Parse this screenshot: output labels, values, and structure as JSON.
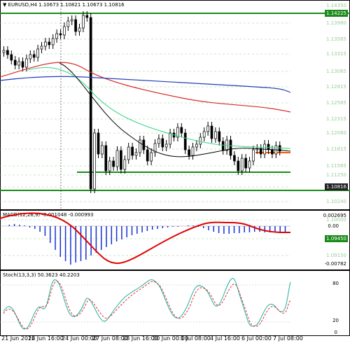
{
  "main_panel": {
    "header": "EURUSD,H4  1.10673 1.10821 1.10673 1.10816",
    "price_labels": [
      "1.14350",
      "1.14225",
      "1.13980",
      "1.13565",
      "1.13315",
      "1.13065",
      "1.12815",
      "1.12565",
      "1.12315",
      "1.12060",
      "1.11815",
      "1.11565",
      "1.11250",
      "1.10816",
      "1.10240",
      "1.10000",
      "1.09450",
      "1.09150"
    ],
    "current_price": "1.10816",
    "highlight_level": "1.14225",
    "support_level": "1.09450"
  },
  "macd_panel": {
    "header": "MACD(12,26,9) -0.001048 -0.000993",
    "scale_top": "0.002695",
    "scale_zero": "0.00",
    "scale_bottom": "-0.00782"
  },
  "stoch_panel": {
    "header": "Stoch(13,3,3) 50.3623 40.2203",
    "scale_top": "80",
    "scale_mid": "20",
    "scale_bottom": "0"
  },
  "x_axis_labels": [
    "21 Jun 2016",
    "22 Jun 16:00",
    "24 Jun 00:00",
    "27 Jun 08:00",
    "28 Jun 16:00",
    "30 Jun 00:00",
    "1 Jul 08:00",
    "4 Jul 16:00",
    "6 Jul 00:00",
    "7 Jul 08:00"
  ],
  "colors": {
    "ma_red": "#d92b2b",
    "ma_green": "#3bd68a",
    "ma_blue": "#1f3fb8",
    "ma_black": "#000000",
    "level_green": "#1a8a1a",
    "grid": "#2f9a2f",
    "macd_hist": "#1530d0",
    "macd_signal": "#e00000",
    "stoch_main": "#1fb0a0",
    "stoch_signal": "#e03030",
    "level_orange": "#ff5a00"
  }
}
